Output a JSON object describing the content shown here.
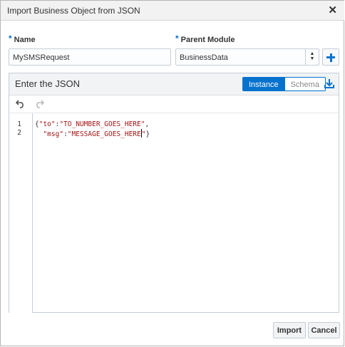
{
  "dialog": {
    "title": "Import Business Object from JSON",
    "close_icon": "close-icon"
  },
  "form": {
    "name_label": "Name",
    "name_value": "MySMSRequest",
    "parent_label": "Parent Module",
    "parent_value": "BusinessData",
    "required_marker": "*"
  },
  "panel": {
    "title": "Enter the JSON",
    "toggle_instance": "Instance",
    "toggle_schema": "Schema",
    "active_toggle": "Instance"
  },
  "editor": {
    "line_numbers": [
      "1",
      "2"
    ],
    "line1": {
      "p1": "{",
      "k1": "\"to\"",
      "p2": ":",
      "v1": "\"TO_NUMBER_GOES_HERE\"",
      "p3": ","
    },
    "line2": {
      "indent": "  ",
      "k2": "\"msg\"",
      "p4": ":",
      "v2a": "\"MESSAGE_GOES_HERE",
      "v2b": "\"",
      "p5": "}"
    }
  },
  "footer": {
    "import_label": "Import",
    "cancel_label": "Cancel"
  },
  "colors": {
    "accent": "#0572ce",
    "string": "#a31515"
  }
}
